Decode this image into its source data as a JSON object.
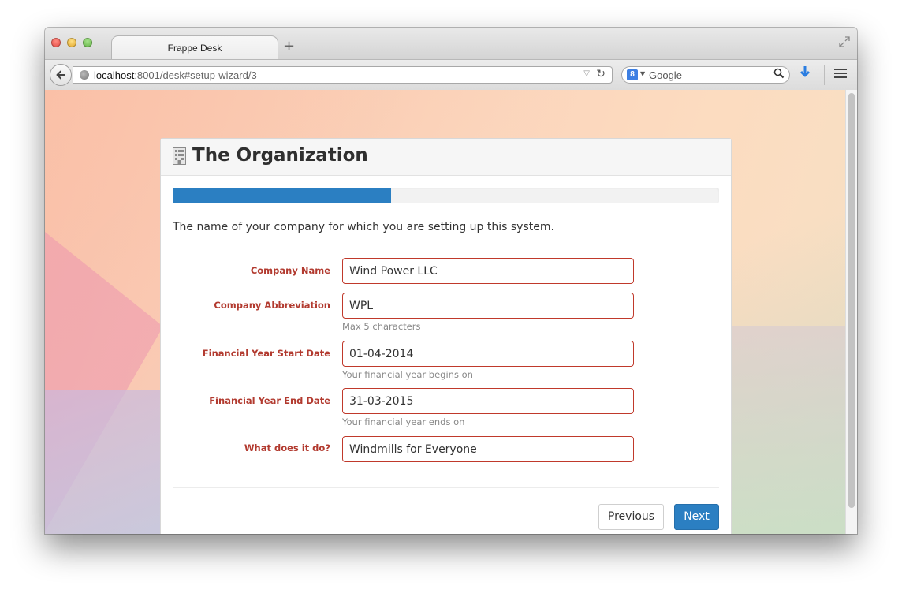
{
  "browser": {
    "tab_title": "Frappe Desk",
    "new_tab_label": "+",
    "url_host": "localhost",
    "url_rest": ":8001/desk#setup-wizard/3",
    "search_placeholder": "Google",
    "search_engine_badge": "8"
  },
  "wizard": {
    "title": "The Organization",
    "progress_fraction": 0.4,
    "intro": "The name of your company for which you are setting up this system.",
    "fields": [
      {
        "label": "Company Name",
        "value": "Wind Power LLC",
        "help": ""
      },
      {
        "label": "Company Abbreviation",
        "value": "WPL",
        "help": "Max 5 characters"
      },
      {
        "label": "Financial Year Start Date",
        "value": "01-04-2014",
        "help": "Your financial year begins on"
      },
      {
        "label": "Financial Year End Date",
        "value": "31-03-2015",
        "help": "Your financial year ends on"
      },
      {
        "label": "What does it do?",
        "value": "Windmills for Everyone",
        "help": ""
      }
    ],
    "buttons": {
      "previous": "Previous",
      "next": "Next"
    }
  },
  "colors": {
    "accent": "#2b7fc2",
    "required_label": "#b23a2f",
    "input_border": "#c0392b"
  },
  "icons": {
    "title_icon": "building-icon",
    "back": "back-arrow-icon",
    "reload": "reload-icon",
    "download": "download-arrow-icon",
    "menu": "hamburger-menu-icon"
  }
}
